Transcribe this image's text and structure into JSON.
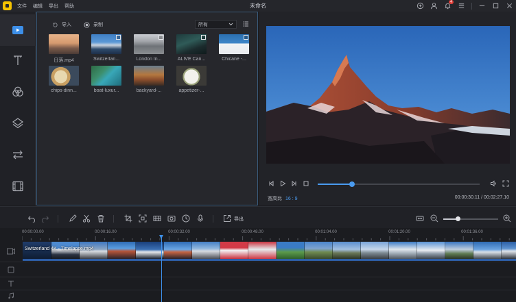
{
  "window": {
    "title": "未命名",
    "menu": [
      "文件",
      "编辑",
      "导出",
      "帮助"
    ],
    "notification_count": "4"
  },
  "rail": {
    "items": [
      {
        "name": "media-icon",
        "active": true
      },
      {
        "name": "text-icon",
        "active": false
      },
      {
        "name": "filter-icon",
        "active": false
      },
      {
        "name": "overlay-icon",
        "active": false
      },
      {
        "name": "transition-icon",
        "active": false
      },
      {
        "name": "elements-icon",
        "active": false
      }
    ]
  },
  "media": {
    "import_label": "导入",
    "record_label": "录制",
    "filter_value": "所有",
    "clips": [
      {
        "name": "日落.mp4"
      },
      {
        "name": "Switzerlan..."
      },
      {
        "name": "London In..."
      },
      {
        "name": "ALIVE Can..."
      },
      {
        "name": "Chicane -..."
      },
      {
        "name": "chips-dinn..."
      },
      {
        "name": "boat-luxur..."
      },
      {
        "name": "backyard-..."
      },
      {
        "name": "appetizer-..."
      }
    ]
  },
  "preview": {
    "ratio_label": "宽高比",
    "ratio_value": "16 : 9",
    "time_display": "00:00:30.11 / 00:02:27.10",
    "progress_fraction": 0.21
  },
  "toolbar": {
    "export_label": "导出",
    "zoom_fraction": 0.26
  },
  "timeline": {
    "ruler_labels": [
      "00:00:00.00",
      "00:00:16.00",
      "00:00:32.00",
      "00:00:48.00",
      "00:01:04.00",
      "00:01:20.00",
      "00:01:36.00"
    ],
    "clip_title": "Switzerland 4K - Timelapse.mp4"
  },
  "colors": {
    "accent": "#4a9bf0",
    "logo": "#f4c200",
    "panel_border": "#3a5a7a"
  }
}
